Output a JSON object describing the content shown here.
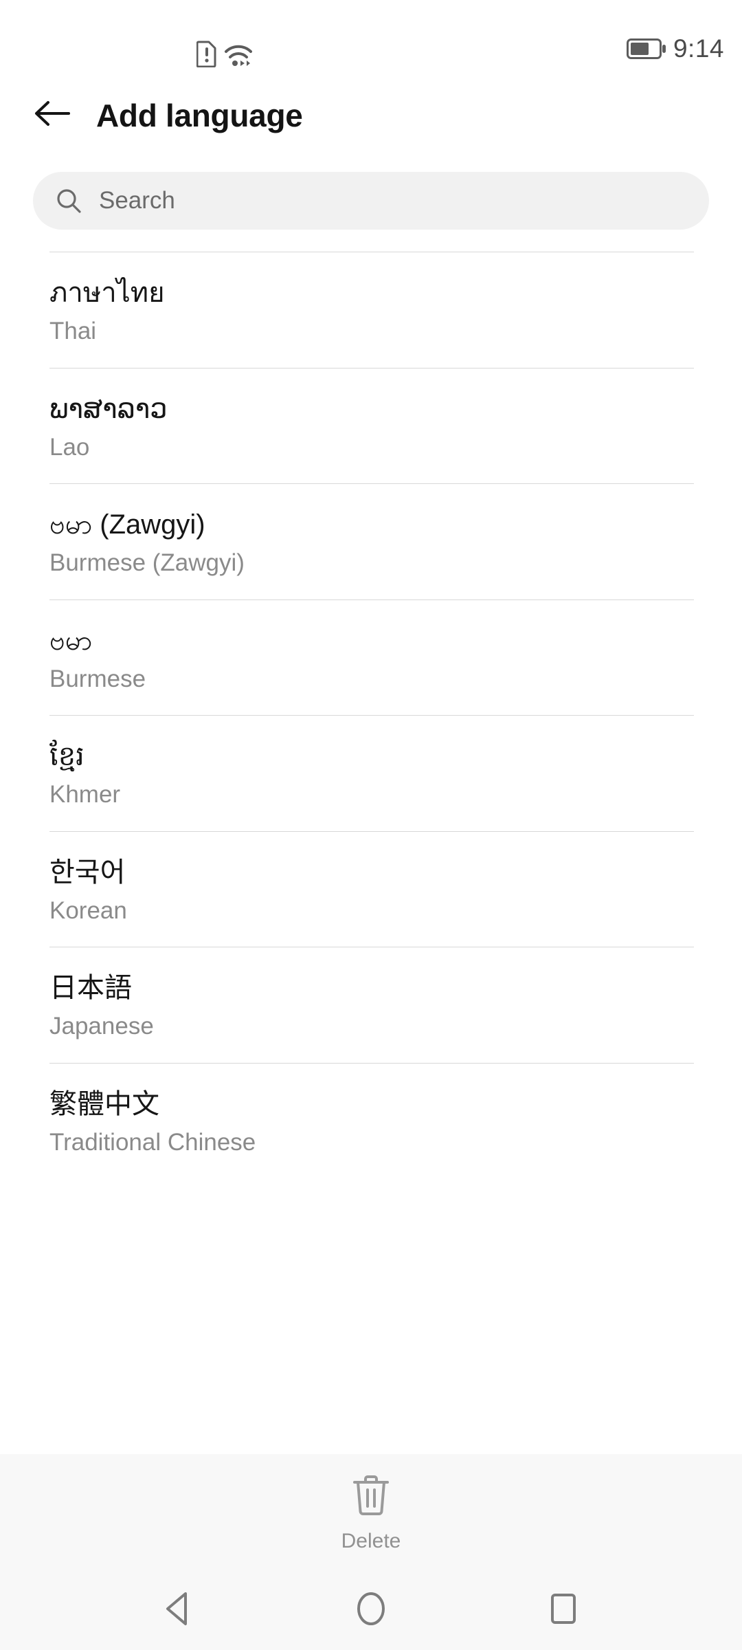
{
  "status_bar": {
    "sim_icon": "sim-card-alert-icon",
    "wifi_icon": "wifi-icon",
    "battery_icon": "battery-icon",
    "battery_level_percent": 60,
    "time": "9:14"
  },
  "header": {
    "back_icon": "back-arrow-icon",
    "title": "Add language"
  },
  "search": {
    "icon": "search-icon",
    "placeholder": "Search",
    "value": ""
  },
  "list": {
    "items": [
      {
        "native": "ภาษาไทย",
        "english": "Thai"
      },
      {
        "native": "ພາສາລາວ",
        "english": "Lao"
      },
      {
        "native": "ဗမာ (Zawgyi)",
        "english": "Burmese (Zawgyi)"
      },
      {
        "native": "ဗမာ",
        "english": "Burmese"
      },
      {
        "native": "ខ្មែរ",
        "english": "Khmer"
      },
      {
        "native": "한국어",
        "english": "Korean"
      },
      {
        "native": "日本語",
        "english": "Japanese"
      },
      {
        "native": "繁體中文",
        "english": "Traditional Chinese"
      }
    ]
  },
  "action_bar": {
    "delete_icon": "trash-icon",
    "delete_label": "Delete"
  },
  "nav_bar": {
    "back_icon": "nav-back-triangle-icon",
    "home_icon": "nav-home-circle-icon",
    "recents_icon": "nav-recents-square-icon"
  },
  "colors": {
    "background": "#ffffff",
    "search_field": "#f1f1f1",
    "divider": "#d8d8d8",
    "primary_text": "#161616",
    "secondary_text": "#8a8a8a",
    "bottom_bar": "#f8f8f8",
    "icon_gray": "#9a9a9a"
  }
}
